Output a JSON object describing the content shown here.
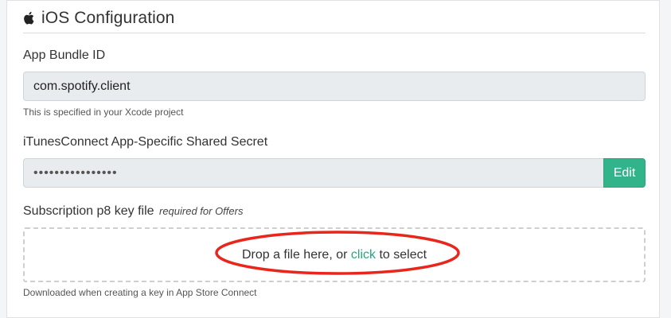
{
  "section": {
    "title": "iOS Configuration",
    "icon": "apple-icon"
  },
  "bundle_id": {
    "label": "App Bundle ID",
    "value": "com.spotify.client",
    "help": "This is specified in your Xcode project"
  },
  "shared_secret": {
    "label": "iTunesConnect App-Specific Shared Secret",
    "value": "••••••••••••••••",
    "edit_label": "Edit"
  },
  "p8_key": {
    "label": "Subscription p8 key file",
    "note": "required for Offers",
    "drop_prefix": "Drop a file here, or",
    "drop_link": "click",
    "drop_suffix": "to select",
    "help": "Downloaded when creating a key in App Store Connect"
  },
  "colors": {
    "accent": "#33b38a",
    "link": "#2aa57c",
    "annotation": "#e8261c"
  }
}
